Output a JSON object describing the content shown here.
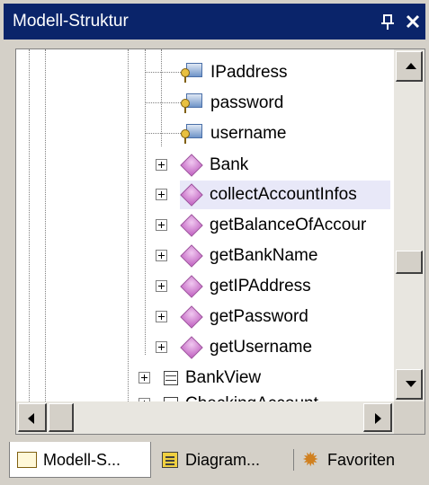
{
  "window": {
    "title": "Modell-Struktur",
    "pin_glyph": "⨿",
    "pin_icon": "pin-icon",
    "close_glyph": "✕",
    "close_icon": "close-icon"
  },
  "tree": {
    "attributes": [
      {
        "label": "IPaddress",
        "icon": "key-attribute-icon"
      },
      {
        "label": "password",
        "icon": "key-attribute-icon"
      },
      {
        "label": "username",
        "icon": "key-attribute-icon"
      }
    ],
    "operations": [
      {
        "label": "Bank",
        "icon": "operation-icon"
      },
      {
        "label": "collectAccountInfos",
        "icon": "operation-icon",
        "selected": true
      },
      {
        "label": "getBalanceOfAccour",
        "icon": "operation-icon"
      },
      {
        "label": "getBankName",
        "icon": "operation-icon"
      },
      {
        "label": "getIPAddress",
        "icon": "operation-icon"
      },
      {
        "label": "getPassword",
        "icon": "operation-icon"
      },
      {
        "label": "getUsername",
        "icon": "operation-icon"
      }
    ],
    "classes": [
      {
        "label": "BankView",
        "icon": "class-icon"
      },
      {
        "label": "CheckingAccount",
        "icon": "class-icon"
      }
    ],
    "selection_color": "#e8e8f8"
  },
  "tabs": [
    {
      "label": "Modell-S...",
      "icon": "folder-icon",
      "active": true
    },
    {
      "label": "Diagram...",
      "icon": "diagram-icon",
      "active": false
    },
    {
      "label": "Favoriten",
      "icon": "favorites-icon",
      "active": false
    }
  ],
  "colors": {
    "titlebar": "#0a246a",
    "chrome": "#d4d0c8",
    "operation": "#c060c0"
  }
}
